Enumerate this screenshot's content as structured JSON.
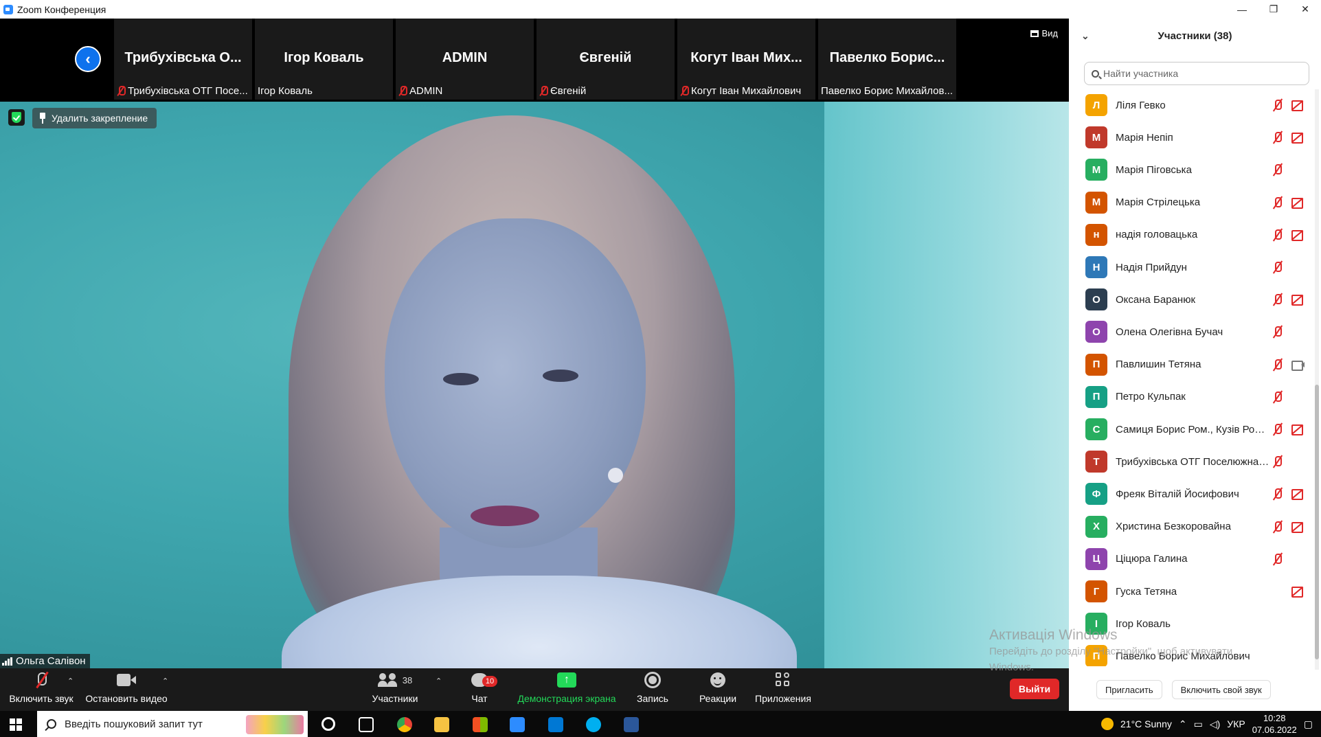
{
  "window": {
    "title": "Zoom Конференция"
  },
  "strip": {
    "view_label": "Вид",
    "thumbnails": [
      {
        "name": "Трибухівська О...",
        "label": "Трибухівська ОТГ Посе...",
        "muted": true
      },
      {
        "name": "Ігор Коваль",
        "label": "Ігор Коваль",
        "muted": false
      },
      {
        "name": "ADMIN",
        "label": "ADMIN",
        "muted": true
      },
      {
        "name": "Євгеній",
        "label": "Євгеній",
        "muted": true
      },
      {
        "name": "Когут Іван Мих...",
        "label": "Когут Іван Михайлович",
        "muted": true
      },
      {
        "name": "Павелко Борис...",
        "label": "Павелко Борис Михайлов...",
        "muted": false
      }
    ]
  },
  "main": {
    "unpin_label": "Удалить закрепление",
    "speaker_name": "Ольга Салівон"
  },
  "toolbar": {
    "unmute_label": "Включить звук",
    "stop_video_label": "Остановить видео",
    "participants_label": "Участники",
    "participants_count": "38",
    "chat_label": "Чат",
    "chat_badge": "10",
    "share_label": "Демонстрация экрана",
    "record_label": "Запись",
    "reactions_label": "Реакции",
    "apps_label": "Приложения",
    "leave_label": "Выйти"
  },
  "panel": {
    "title": "Участники (38)",
    "search_placeholder": "Найти участника",
    "invite_label": "Пригласить",
    "unmute_self_label": "Включить свой звук",
    "participants": [
      {
        "initial": "Л",
        "name": "Ліля Гевко",
        "color": "#f4a300",
        "mic": "off",
        "video": "off"
      },
      {
        "initial": "М",
        "name": "Марія Непіп",
        "color": "#c0392b",
        "mic": "off",
        "video": "off"
      },
      {
        "initial": "М",
        "name": "Марія Піговська",
        "color": "#27ae60",
        "mic": "off",
        "video": "none"
      },
      {
        "initial": "М",
        "name": "Марія Стрілецька",
        "color": "#d35400",
        "mic": "off",
        "video": "off"
      },
      {
        "initial": "н",
        "name": "надія головацька",
        "color": "#d35400",
        "mic": "off",
        "video": "off"
      },
      {
        "initial": "Н",
        "name": "Надія Прийдун",
        "color": "#2e78b7",
        "mic": "off",
        "video": "none"
      },
      {
        "initial": "О",
        "name": "Оксана Баранюк",
        "color": "#2c3e50",
        "mic": "off",
        "video": "off"
      },
      {
        "initial": "О",
        "name": "Олена Олегівна Бучач",
        "color": "#8e44ad",
        "mic": "off",
        "video": "none"
      },
      {
        "initial": "П",
        "name": "Павлишин Тетяна",
        "color": "#d35400",
        "mic": "off",
        "video": "on"
      },
      {
        "initial": "П",
        "name": "Петро Кульпак",
        "color": "#16a085",
        "mic": "off",
        "video": "none"
      },
      {
        "initial": "С",
        "name": "Самиця Борис Ром., Кузів Ром...",
        "color": "#27ae60",
        "mic": "off",
        "video": "off"
      },
      {
        "initial": "Т",
        "name": "Трибухівська ОТГ Поселюжна Л.М.",
        "color": "#c0392b",
        "mic": "off",
        "video": "none"
      },
      {
        "initial": "Ф",
        "name": "Фреяк Віталій Йосифович",
        "color": "#16a085",
        "mic": "off",
        "video": "off"
      },
      {
        "initial": "Х",
        "name": "Христина Безкоровайна",
        "color": "#27ae60",
        "mic": "off",
        "video": "off"
      },
      {
        "initial": "Ц",
        "name": "Ціцюра Галина",
        "color": "#8e44ad",
        "mic": "off",
        "video": "none"
      },
      {
        "initial": "Г",
        "name": "Гуска Тетяна",
        "color": "#d35400",
        "mic": "none",
        "video": "off"
      },
      {
        "initial": "І",
        "name": "Ігор Коваль",
        "color": "#27ae60",
        "mic": "none",
        "video": "none"
      },
      {
        "initial": "П",
        "name": "Павелко Борис Михайлович",
        "color": "#f4a300",
        "mic": "none",
        "video": "none"
      }
    ]
  },
  "activation": {
    "title": "Активація Windows",
    "subtitle1": "Перейдіть до розділу \"Настройки\", щоб активувати",
    "subtitle2": "Windows."
  },
  "taskbar": {
    "search_placeholder": "Введіть пошуковий запит тут",
    "weather": "21°C  Sunny",
    "language": "УКР",
    "time": "10:28",
    "date": "07.06.2022"
  }
}
